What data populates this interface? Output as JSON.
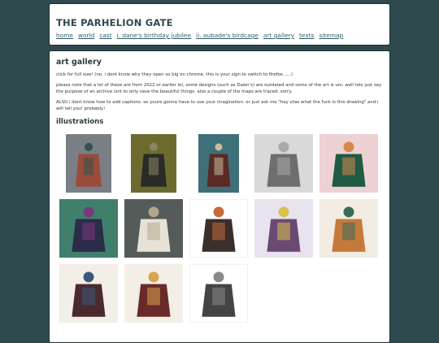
{
  "header": {
    "title": "THE PARHELION GATE",
    "nav": [
      "home",
      "world",
      "cast",
      "i. dane's birthday jubilee",
      "ii. aubade's birdcage",
      "art gallery",
      "texts",
      "sitemap"
    ]
  },
  "main": {
    "title": "art gallery",
    "paragraphs": [
      "click for full size! (no, i dont know why they open so big on chrome. this is your sign to switch to firefox......)",
      "please note that a lot of these are from 2022 or earlier lol, some designs (such as Dawn's) are outdated and some of the art is um. well lets just say the purpose of an archive isnt to only save the beautiful things. also a couple of the maps are traced. sorry.",
      "ALSO i dont know how to add captions. so youre gonna have to use your imagination. or just ask me \"hey silas what the fuck is this drawing\" and i will tell you! probably!"
    ],
    "section_title": "illustrations",
    "thumbnails": [
      {
        "bg": "#7a7f86",
        "fig": "#9a4c3a",
        "alt": "#35524c"
      },
      {
        "bg": "#6d6a2f",
        "fig": "#2a2a26",
        "alt": "#8b8566"
      },
      {
        "bg": "#3f6f78",
        "fig": "#5a2a24",
        "alt": "#c9bca0"
      },
      {
        "bg": "#d9d9d9",
        "fig": "#6e6e6e",
        "alt": "#a9a9a9"
      },
      {
        "bg": "#ecd2d2",
        "fig": "#1f5a45",
        "alt": "#d8894e"
      },
      {
        "bg": "#3f7f6c",
        "fig": "#2a2c4a",
        "alt": "#7a3a7a"
      },
      {
        "bg": "#555b5a",
        "fig": "#e8e2d6",
        "alt": "#b0a78c"
      },
      {
        "bg": "#ffffff",
        "fig": "#3a2f2a",
        "alt": "#c66a3a"
      },
      {
        "bg": "#e8e3ee",
        "fig": "#6a4a72",
        "alt": "#d9c24e"
      },
      {
        "bg": "#f2ece2",
        "fig": "#c67a3a",
        "alt": "#3a6a5a"
      },
      {
        "bg": "#f3eee6",
        "fig": "#4a2a2f",
        "alt": "#3a5a7a"
      },
      {
        "bg": "#f3eee6",
        "fig": "#6a2a2a",
        "alt": "#d9a44e"
      },
      {
        "bg": "#ffffff",
        "fig": "#444444",
        "alt": "#888888"
      }
    ]
  }
}
